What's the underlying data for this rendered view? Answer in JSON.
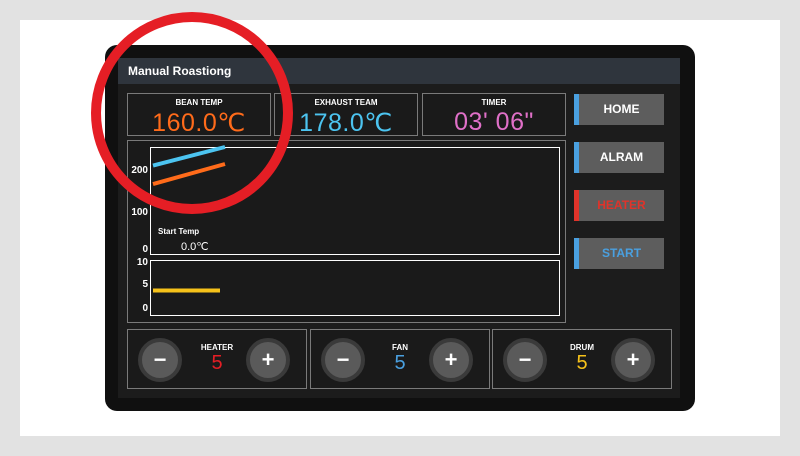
{
  "window": {
    "title": "Manual Roastiong"
  },
  "readouts": {
    "bean_temp": {
      "label": "BEAN TEMP",
      "value": "160.0℃",
      "color": "#ff6b1a"
    },
    "exhaust_temp": {
      "label": "EXHAUST TEAM",
      "value": "178.0℃",
      "color": "#4cc4f0"
    },
    "timer": {
      "label": "TIMER",
      "value": "03' 06\"",
      "color": "#e070c8"
    }
  },
  "nav": {
    "home": "HOME",
    "alarm": "ALRAM",
    "heater": "HEATER",
    "start": "START",
    "heater_color": "#e0332a",
    "start_color": "#4aa0e0"
  },
  "temp_chart": {
    "axis_labels": [
      "200",
      "100",
      "0"
    ],
    "start_temp_label": "Start  Temp",
    "start_temp_value": "0.0℃"
  },
  "level_chart": {
    "axis_labels": [
      "10",
      "5",
      "0"
    ]
  },
  "controls": {
    "heater": {
      "label": "HEATER",
      "value": "5",
      "color": "#e51e25"
    },
    "fan": {
      "label": "FAN",
      "value": "5",
      "color": "#4aa0e0"
    },
    "drum": {
      "label": "DRUM",
      "value": "5",
      "color": "#f6c21a"
    },
    "minus": "−",
    "plus": "+"
  },
  "chart_data": [
    {
      "type": "line",
      "ylim": [
        0,
        200
      ],
      "series": [
        {
          "color": "#4cc4f0",
          "values": [
            165,
            200
          ]
        },
        {
          "color": "#ff6b1a",
          "values": [
            130,
            168
          ]
        }
      ]
    },
    {
      "type": "line",
      "ylim": [
        0,
        10
      ],
      "series": [
        {
          "color": "#f6c21a",
          "values": [
            5,
            5
          ]
        }
      ]
    }
  ]
}
